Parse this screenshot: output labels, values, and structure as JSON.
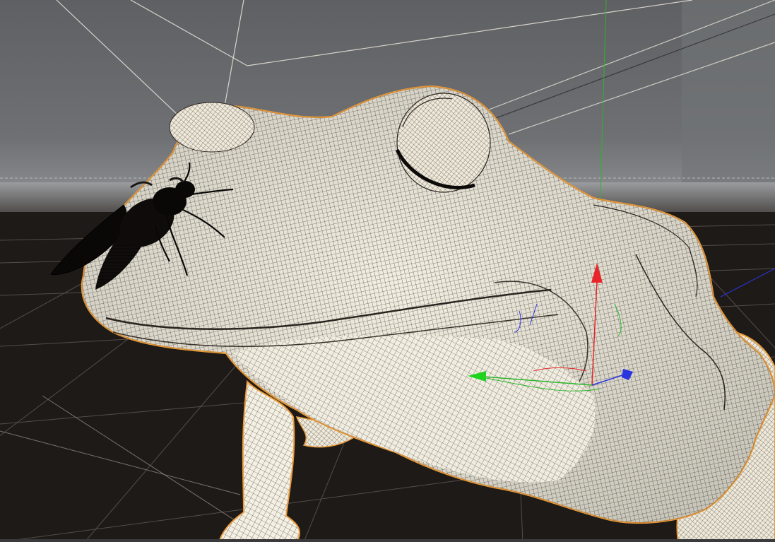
{
  "viewport": {
    "background_sky": "#6b6c6e",
    "floor_color": "#1d1917",
    "horizon_band": "#8b8d90",
    "grid_line_color": "#6f6862",
    "selection_outline_color": "#e89a3a",
    "mesh_fill_color": "#f3efe2",
    "mesh_wire_color": "#2a2420"
  },
  "gizmo": {
    "x_axis_color": "#1fd31f",
    "y_axis_color": "#e8252a",
    "z_axis_color": "#2a35e0"
  },
  "objects": [
    {
      "name": "frog",
      "icon": "frog-mesh-icon",
      "selected": true
    },
    {
      "name": "fly",
      "icon": "fly-mesh-icon",
      "selected": false
    }
  ]
}
